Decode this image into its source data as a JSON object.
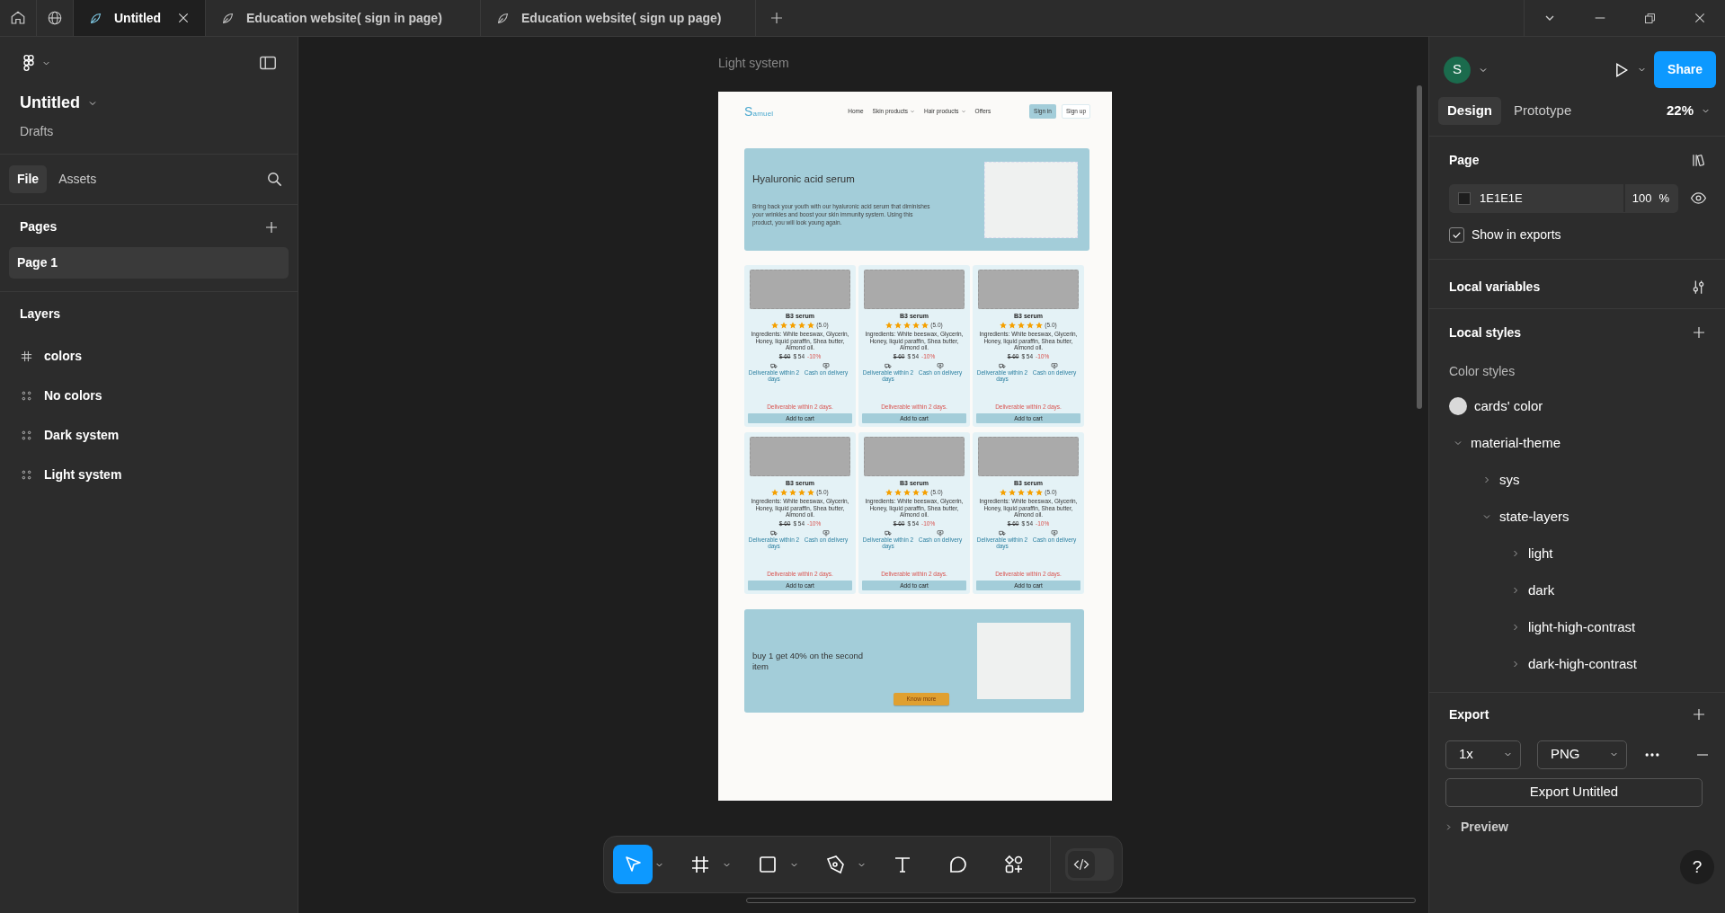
{
  "title_bar": {
    "tabs": [
      {
        "label": "Untitled",
        "selected": true
      },
      {
        "label": "Education website( sign in page)",
        "selected": false
      },
      {
        "label": "Education website( sign up page)",
        "selected": false
      }
    ]
  },
  "left_panel": {
    "file": {
      "name": "Untitled",
      "location": "Drafts"
    },
    "tabs": [
      {
        "label": "File",
        "selected": true
      },
      {
        "label": "Assets",
        "selected": false
      }
    ],
    "pages": {
      "title": "Pages",
      "items": [
        {
          "label": "Page 1",
          "selected": true
        }
      ]
    },
    "layers": {
      "title": "Layers",
      "items": [
        {
          "label": "colors",
          "kind": "frame"
        },
        {
          "label": "No colors",
          "kind": "section"
        },
        {
          "label": "Dark system",
          "kind": "section"
        },
        {
          "label": "Light system",
          "kind": "section"
        }
      ]
    }
  },
  "canvas": {
    "frame": {
      "label": "Light system",
      "logo": "Samuel",
      "nav": [
        {
          "label": "Home",
          "dropdown": false
        },
        {
          "label": "Skin products",
          "dropdown": true
        },
        {
          "label": "Hair products",
          "dropdown": true
        },
        {
          "label": "Offers",
          "dropdown": false
        }
      ],
      "auth": [
        {
          "label": "Sign in",
          "kind": "filled"
        },
        {
          "label": "Sign up",
          "kind": "outline"
        }
      ],
      "hero": {
        "title": "Hyaluronic acid serum",
        "text": "Bring back your youth with our hyaluronic acid serum that diminishes your wrinkles and boost your skin immunity system. Using this product, you will look young again."
      },
      "products": [
        {
          "name": "B3 serum",
          "stars": 5,
          "rating": "(5.0)",
          "ingredients": "Ingredients: White beeswax, Glycerin, Honey, liquid paraffin, Shea butter, Almond oil.",
          "old_price": "$ 60",
          "price": "$ 54",
          "discount": "-10%",
          "features": [
            {
              "kind": "truck",
              "label": "Deliverable within 2 days"
            },
            {
              "kind": "cash",
              "label": "Cash on delivery"
            }
          ],
          "note": "Deliverable within 2 days.",
          "button": "Add to cart"
        },
        {
          "name": "B3 serum",
          "stars": 5,
          "rating": "(5.0)",
          "ingredients": "Ingredients: White beeswax, Glycerin, Honey, liquid paraffin, Shea butter, Almond oil.",
          "old_price": "$ 60",
          "price": "$ 54",
          "discount": "-10%",
          "features": [
            {
              "kind": "truck",
              "label": "Deliverable within 2 days"
            },
            {
              "kind": "cash",
              "label": "Cash on delivery"
            }
          ],
          "note": "Deliverable within 2 days.",
          "button": "Add to cart"
        },
        {
          "name": "B3 serum",
          "stars": 5,
          "rating": "(5.0)",
          "ingredients": "Ingredients: White beeswax, Glycerin, Honey, liquid paraffin, Shea butter, Almond oil.",
          "old_price": "$ 60",
          "price": "$ 54",
          "discount": "-10%",
          "features": [
            {
              "kind": "truck",
              "label": "Deliverable within 2 days"
            },
            {
              "kind": "cash",
              "label": "Cash on delivery"
            }
          ],
          "note": "Deliverable within 2 days.",
          "button": "Add to cart"
        },
        {
          "name": "B3 serum",
          "stars": 5,
          "rating": "(5.0)",
          "ingredients": "Ingredients: White beeswax, Glycerin, Honey, liquid paraffin, Shea butter, Almond oil.",
          "old_price": "$ 60",
          "price": "$ 54",
          "discount": "-10%",
          "features": [
            {
              "kind": "truck",
              "label": "Deliverable within 2 days"
            },
            {
              "kind": "cash",
              "label": "Cash on delivery"
            }
          ],
          "note": "Deliverable within 2 days.",
          "button": "Add to cart"
        },
        {
          "name": "B3 serum",
          "stars": 5,
          "rating": "(5.0)",
          "ingredients": "Ingredients: White beeswax, Glycerin, Honey, liquid paraffin, Shea butter, Almond oil.",
          "old_price": "$ 60",
          "price": "$ 54",
          "discount": "-10%",
          "features": [
            {
              "kind": "truck",
              "label": "Deliverable within 2 days"
            },
            {
              "kind": "cash",
              "label": "Cash on delivery"
            }
          ],
          "note": "Deliverable within 2 days.",
          "button": "Add to cart"
        },
        {
          "name": "B3 serum",
          "stars": 5,
          "rating": "(5.0)",
          "ingredients": "Ingredients: White beeswax, Glycerin, Honey, liquid paraffin, Shea butter, Almond oil.",
          "old_price": "$ 60",
          "price": "$ 54",
          "discount": "-10%",
          "features": [
            {
              "kind": "truck",
              "label": "Deliverable within 2 days"
            },
            {
              "kind": "cash",
              "label": "Cash on delivery"
            }
          ],
          "note": "Deliverable within 2 days.",
          "button": "Add to cart"
        }
      ],
      "promo": {
        "title": "buy 1 get 40% on the second item",
        "button": "Know more"
      }
    }
  },
  "toolbar": {
    "tools": [
      {
        "kind": "move",
        "selected": true,
        "menu": true
      },
      {
        "kind": "frame",
        "selected": false,
        "menu": true
      },
      {
        "kind": "rectangle",
        "selected": false,
        "menu": true
      },
      {
        "kind": "pen",
        "selected": false,
        "menu": true
      },
      {
        "kind": "text",
        "selected": false,
        "menu": false
      },
      {
        "kind": "comment",
        "selected": false,
        "menu": false
      },
      {
        "kind": "actions",
        "selected": false,
        "menu": false
      }
    ],
    "dev_mode": false
  },
  "right_panel": {
    "avatar": "S",
    "share": "Share",
    "tabs": [
      {
        "label": "Design",
        "selected": true
      },
      {
        "label": "Prototype",
        "selected": false
      }
    ],
    "zoom": "22%",
    "page": {
      "title": "Page",
      "color": "1E1E1E",
      "opacity": "100",
      "unit": "%",
      "show_in_exports": {
        "label": "Show in exports",
        "checked": true
      }
    },
    "local_variables": "Local variables",
    "local_styles": {
      "title": "Local styles",
      "subtitle": "Color styles",
      "styles": [
        {
          "label": "cards' color",
          "color": "#d9d9d9"
        }
      ],
      "tree": [
        {
          "label": "material-theme",
          "expanded": true,
          "children": [
            {
              "label": "sys",
              "expanded": false
            },
            {
              "label": "state-layers",
              "expanded": true,
              "children": [
                {
                  "label": "light",
                  "expanded": false
                },
                {
                  "label": "dark",
                  "expanded": false
                },
                {
                  "label": "light-high-contrast",
                  "expanded": false
                },
                {
                  "label": "dark-high-contrast",
                  "expanded": false
                }
              ]
            }
          ]
        }
      ]
    },
    "export": {
      "title": "Export",
      "scale": "1x",
      "format": "PNG",
      "button": "Export Untitled",
      "preview": "Preview"
    },
    "help": "?"
  }
}
